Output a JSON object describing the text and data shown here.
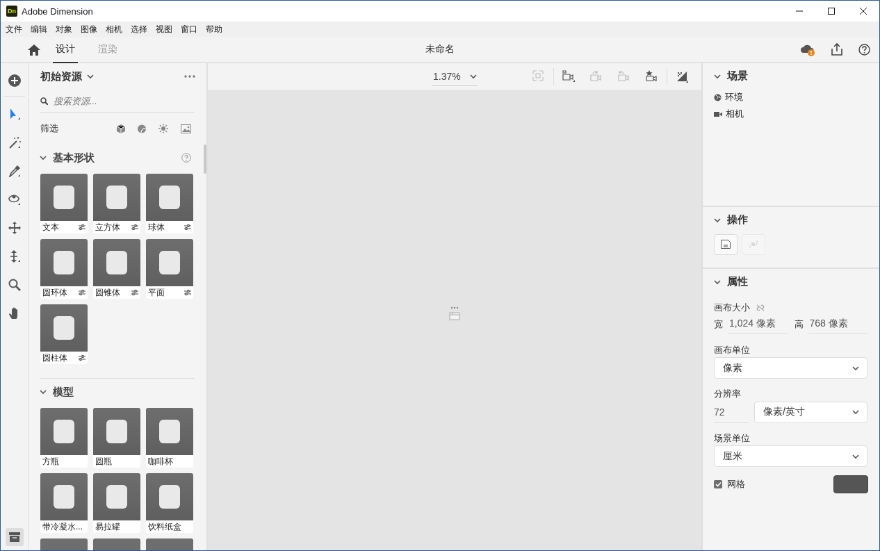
{
  "window": {
    "logo": "Dn",
    "title": "Adobe Dimension"
  },
  "menu": [
    "文件",
    "编辑",
    "对象",
    "图像",
    "相机",
    "选择",
    "视图",
    "窗口",
    "帮助"
  ],
  "tabs": [
    {
      "label": "设计",
      "selected": true
    },
    {
      "label": "渲染",
      "selected": false
    }
  ],
  "document_title": "未命名",
  "tools": [
    {
      "selected": false
    },
    {
      "selected": true
    },
    {
      "selected": false
    },
    {
      "selected": false
    },
    {
      "selected": false
    },
    {
      "selected": false
    },
    {
      "selected": false
    },
    {
      "selected": false
    },
    {
      "selected": false
    }
  ],
  "assets": {
    "title": "初始资源",
    "search": {
      "placeholder": "搜索资源..."
    },
    "filter_label": "筛选",
    "sections": [
      {
        "title": "基本形状",
        "expanded": true,
        "items": [
          {
            "kind": "tile",
            "label": "文本",
            "adjustable": true
          },
          {
            "kind": "tile",
            "label": "立方体",
            "adjustable": true
          },
          {
            "kind": "tile",
            "label": "球体",
            "adjustable": true
          },
          {
            "kind": "tile",
            "label": "圆环体",
            "adjustable": true
          },
          {
            "kind": "tile",
            "label": "圆锥体",
            "adjustable": true
          },
          {
            "kind": "tile",
            "label": "平面",
            "adjustable": true
          },
          {
            "kind": "tile",
            "label": "圆柱体",
            "adjustable": true
          }
        ]
      },
      {
        "title": "模型",
        "expanded": true,
        "items": [
          {
            "kind": "tile",
            "label": "方瓶",
            "adjustable": false
          },
          {
            "kind": "tile",
            "label": "圆瓶",
            "adjustable": false
          },
          {
            "kind": "tile",
            "label": "咖啡杯",
            "adjustable": false
          },
          {
            "kind": "tile",
            "label": "带冷凝水...",
            "adjustable": false
          },
          {
            "kind": "tile",
            "label": "易拉罐",
            "adjustable": false
          },
          {
            "kind": "tile",
            "label": "饮料纸盒",
            "adjustable": false
          },
          {
            "kind": "cut"
          },
          {
            "kind": "cut"
          },
          {
            "kind": "cut"
          }
        ]
      }
    ]
  },
  "canvas": {
    "zoom": "1.37%"
  },
  "scene": {
    "title": "场景",
    "expanded": true,
    "items": [
      {
        "kind": "environment",
        "label": "环境"
      },
      {
        "kind": "camera",
        "label": "相机"
      }
    ]
  },
  "actions": {
    "title": "操作",
    "expanded": true,
    "buttons": [
      {
        "disabled": false
      },
      {
        "disabled": true
      }
    ]
  },
  "properties": {
    "title": "属性",
    "expanded": true,
    "canvas_size_label": "画布大小",
    "width_label": "宽",
    "width": "1,024 像素",
    "height_label": "高",
    "height": "768 像素",
    "canvas_unit": {
      "label": "画布单位",
      "value": "像素"
    },
    "resolution": {
      "label": "分辨率",
      "value": "72",
      "unit": "像素/英寸"
    },
    "scene_unit": {
      "label": "场景单位",
      "value": "厘米"
    },
    "grid": {
      "label": "网格",
      "checked": true
    }
  }
}
